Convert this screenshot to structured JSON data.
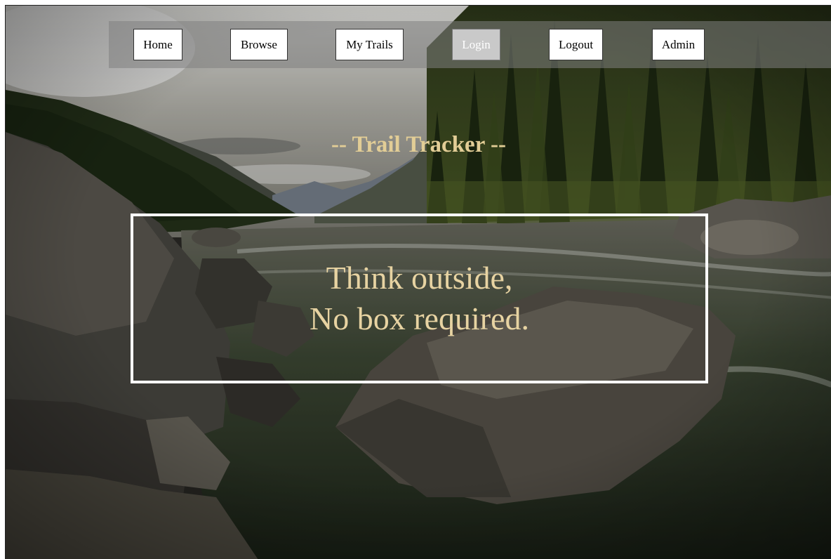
{
  "nav": {
    "items": [
      {
        "label": "Home"
      },
      {
        "label": "Browse"
      },
      {
        "label": "My Trails"
      },
      {
        "label": "Login"
      },
      {
        "label": "Logout"
      },
      {
        "label": "Admin"
      }
    ],
    "active": "Login"
  },
  "header": {
    "title": "-- Trail Tracker --"
  },
  "hero": {
    "line1": "Think outside,",
    "line2": "No box required."
  },
  "colors": {
    "title": "#e2cd96",
    "tagline": "#e7d3a2",
    "nav_bar": "#808080",
    "hero_border": "#ffffff"
  }
}
